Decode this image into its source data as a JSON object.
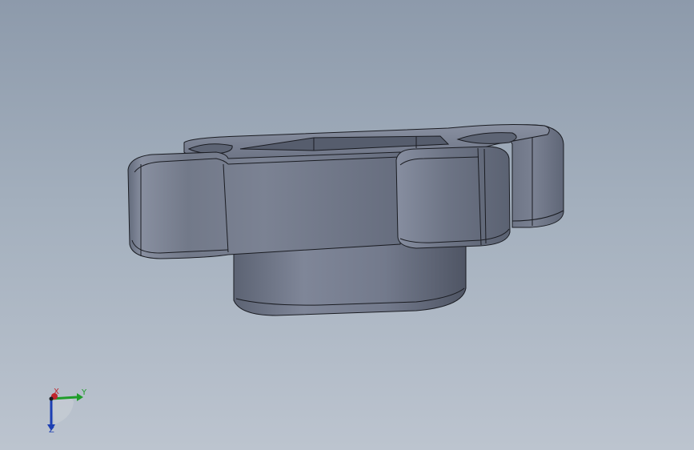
{
  "viewport": {
    "background_top": "#8d9aab",
    "background_bottom": "#bcc4cf"
  },
  "model": {
    "part": "knob-handle",
    "face_color": "#6f7687",
    "edge_color": "#1a1c22"
  },
  "triad": {
    "x_label": "X",
    "y_label": "Y",
    "z_label": "Z",
    "x_color": "#c0272d",
    "y_color": "#1f9d2a",
    "z_color": "#1d3fb3"
  }
}
